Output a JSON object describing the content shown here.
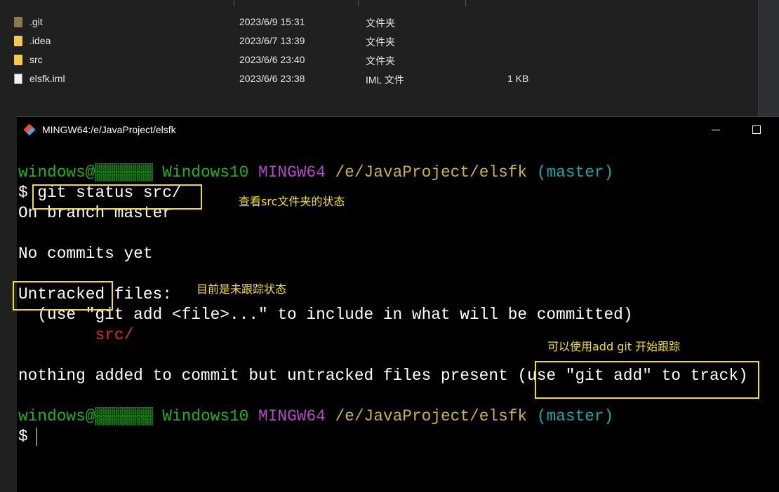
{
  "explorer": {
    "files": [
      {
        "name": ".git",
        "date": "2023/6/9 15:31",
        "type": "文件夹",
        "size": "",
        "icon": "folder-hidden-icon"
      },
      {
        "name": ".idea",
        "date": "2023/6/7 13:39",
        "type": "文件夹",
        "size": "",
        "icon": "folder-icon"
      },
      {
        "name": "src",
        "date": "2023/6/6 23:40",
        "type": "文件夹",
        "size": "",
        "icon": "folder-icon"
      },
      {
        "name": "elsfk.iml",
        "date": "2023/6/6 23:38",
        "type": "IML 文件",
        "size": "1 KB",
        "icon": "file-icon"
      }
    ]
  },
  "terminal": {
    "title": "MINGW64:/e/JavaProject/elsfk",
    "prompt": {
      "user": "windows@",
      "host": "▒▒▒▒▒▒",
      "sys": "Windows10",
      "mingw": "MINGW64",
      "path": "/e/JavaProject/elsfk",
      "branch": "(master)"
    },
    "dollar": "$",
    "command": "git status src/",
    "lines": {
      "l1": "On branch master",
      "l2": "No commits yet",
      "l3a": "Untracked",
      "l3b": " files:",
      "l4": "  (use \"git add <file>...\" to include in what will be committed)",
      "l5": "        src/",
      "l6a": "nothing added to commit but untracked files present (",
      "l6b": "use \"git add\" to track",
      "l6c": ")"
    },
    "colors": {
      "green": "#1db31d",
      "magenta": "#b548c6",
      "yellow": "#c9b53a",
      "cyan": "#17a5a5",
      "red": "#d3303a",
      "annotation": "#f5e20c"
    }
  },
  "annotations": {
    "a1": "查看src文件夹的状态",
    "a2": "目前是未跟踪状态",
    "a3": "可以使用add git 开始跟踪"
  }
}
